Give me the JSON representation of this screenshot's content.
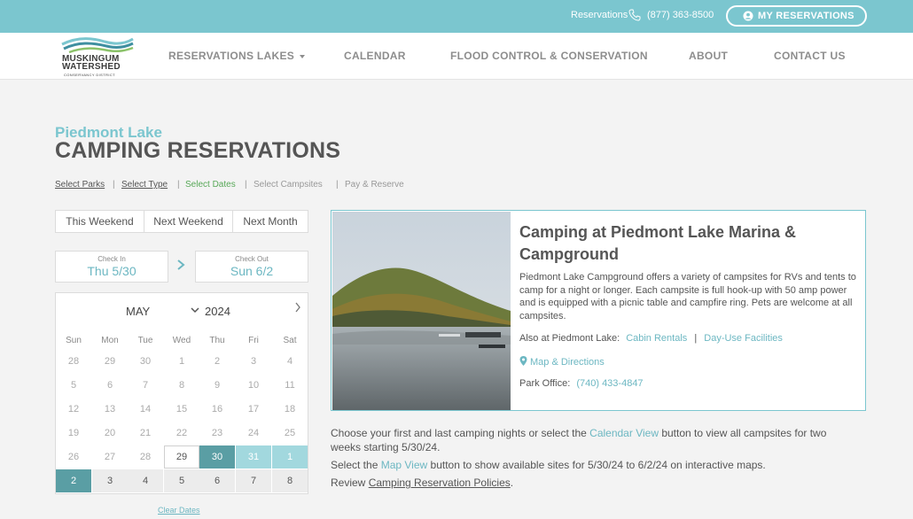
{
  "topbar": {
    "reservations_label": "Reservations",
    "phone": "(877) 363-8500",
    "my_reservations": "MY RESERVATIONS"
  },
  "logo": {
    "line1": "MUSKINGUM",
    "line2": "WATERSHED",
    "line3": "CONSERVANCY DISTRICT"
  },
  "nav": {
    "items": [
      "RESERVATIONS LAKES",
      "CALENDAR",
      "FLOOD CONTROL & CONSERVATION",
      "ABOUT",
      "CONTACT US"
    ]
  },
  "header": {
    "lake": "Piedmont Lake",
    "title": "CAMPING RESERVATIONS"
  },
  "breadcrumb": [
    "Select Parks",
    "Select Type",
    "Select Dates",
    "Select Campsites",
    "Pay & Reserve"
  ],
  "quick_select": [
    "This Weekend",
    "Next Weekend",
    "Next Month"
  ],
  "dates": {
    "checkin_label": "Check In",
    "checkin": "Thu 5/30",
    "checkout_label": "Check Out",
    "checkout": "Sun 6/2"
  },
  "calendar": {
    "month": "MAY",
    "year": "2024",
    "weekdays": [
      "Sun",
      "Mon",
      "Tue",
      "Wed",
      "Thu",
      "Fri",
      "Sat"
    ],
    "rows": [
      [
        "28",
        "29",
        "30",
        "1",
        "2",
        "3",
        "4"
      ],
      [
        "5",
        "6",
        "7",
        "8",
        "9",
        "10",
        "11"
      ],
      [
        "12",
        "13",
        "14",
        "15",
        "16",
        "17",
        "18"
      ],
      [
        "19",
        "20",
        "21",
        "22",
        "23",
        "24",
        "25"
      ],
      [
        "26",
        "27",
        "28",
        "29",
        "30",
        "31",
        "1"
      ],
      [
        "2",
        "3",
        "4",
        "5",
        "6",
        "7",
        "8"
      ]
    ],
    "clear": "Clear Dates"
  },
  "card": {
    "title": "Camping at Piedmont Lake Marina & Campground",
    "description": "Piedmont Lake Campground offers a variety of campsites for RVs and tents to camp for a night or longer. Each campsite is full hook-up with 50 amp power and is equipped with a picnic table and campfire ring. Pets are welcome at all campsites.",
    "also_label": "Also at Piedmont Lake:",
    "also_link1": "Cabin Rentals",
    "separator": "|",
    "also_link2": "Day-Use Facilities",
    "map_link": "Map & Directions",
    "office_label": "Park Office:",
    "office_phone": "(740) 433-4847"
  },
  "instructions": {
    "p1_a": "Choose your first and last camping nights or select the ",
    "p1_link": "Calendar View",
    "p1_b": " button to view all campsites for two weeks starting 5/30/24.",
    "p2_a": "Select the ",
    "p2_link": "Map View",
    "p2_b": " button to show available sites for 5/30/24 to 6/2/24 on interactive maps.",
    "p3_a": "Review ",
    "p3_link": "Camping Reservation Policies",
    "p3_b": "."
  }
}
